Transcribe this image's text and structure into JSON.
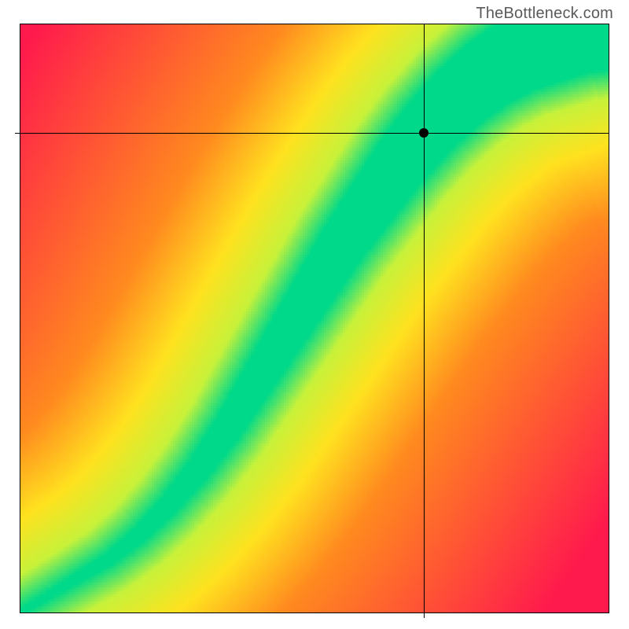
{
  "watermark": "TheBottleneck.com",
  "chart_data": {
    "type": "heatmap",
    "title": "",
    "xlabel": "",
    "ylabel": "",
    "xlim": [
      0,
      1
    ],
    "ylim": [
      0,
      1
    ],
    "grid": false,
    "legend": false,
    "crosshair": {
      "x": 0.685,
      "y": 0.815
    },
    "marker": {
      "x": 0.685,
      "y": 0.815
    },
    "ridge": {
      "description": "Normalized ridge (optimal/green) curve: y as a function of x. Pixel gradient interpolates from red (far) through orange/yellow to green (on-ridge).",
      "x": [
        0.0,
        0.05,
        0.1,
        0.15,
        0.2,
        0.25,
        0.3,
        0.35,
        0.4,
        0.45,
        0.5,
        0.55,
        0.6,
        0.65,
        0.7,
        0.75,
        0.8,
        0.85,
        0.9,
        0.95,
        1.0
      ],
      "y": [
        0.0,
        0.03,
        0.06,
        0.09,
        0.13,
        0.18,
        0.24,
        0.31,
        0.39,
        0.47,
        0.55,
        0.63,
        0.7,
        0.77,
        0.83,
        0.88,
        0.92,
        0.95,
        0.97,
        0.99,
        1.0
      ],
      "width": [
        0.005,
        0.006,
        0.008,
        0.01,
        0.013,
        0.016,
        0.02,
        0.024,
        0.028,
        0.032,
        0.036,
        0.04,
        0.044,
        0.048,
        0.052,
        0.056,
        0.06,
        0.064,
        0.068,
        0.072,
        0.076
      ]
    },
    "color_stops": {
      "red": "#ff1a4d",
      "orange": "#ff8a1f",
      "yellow": "#ffe21f",
      "yelgrn": "#c8f23a",
      "green": "#00d98a"
    },
    "ticks_x": [
      0.685
    ],
    "ticks_y": [
      0.815
    ]
  }
}
